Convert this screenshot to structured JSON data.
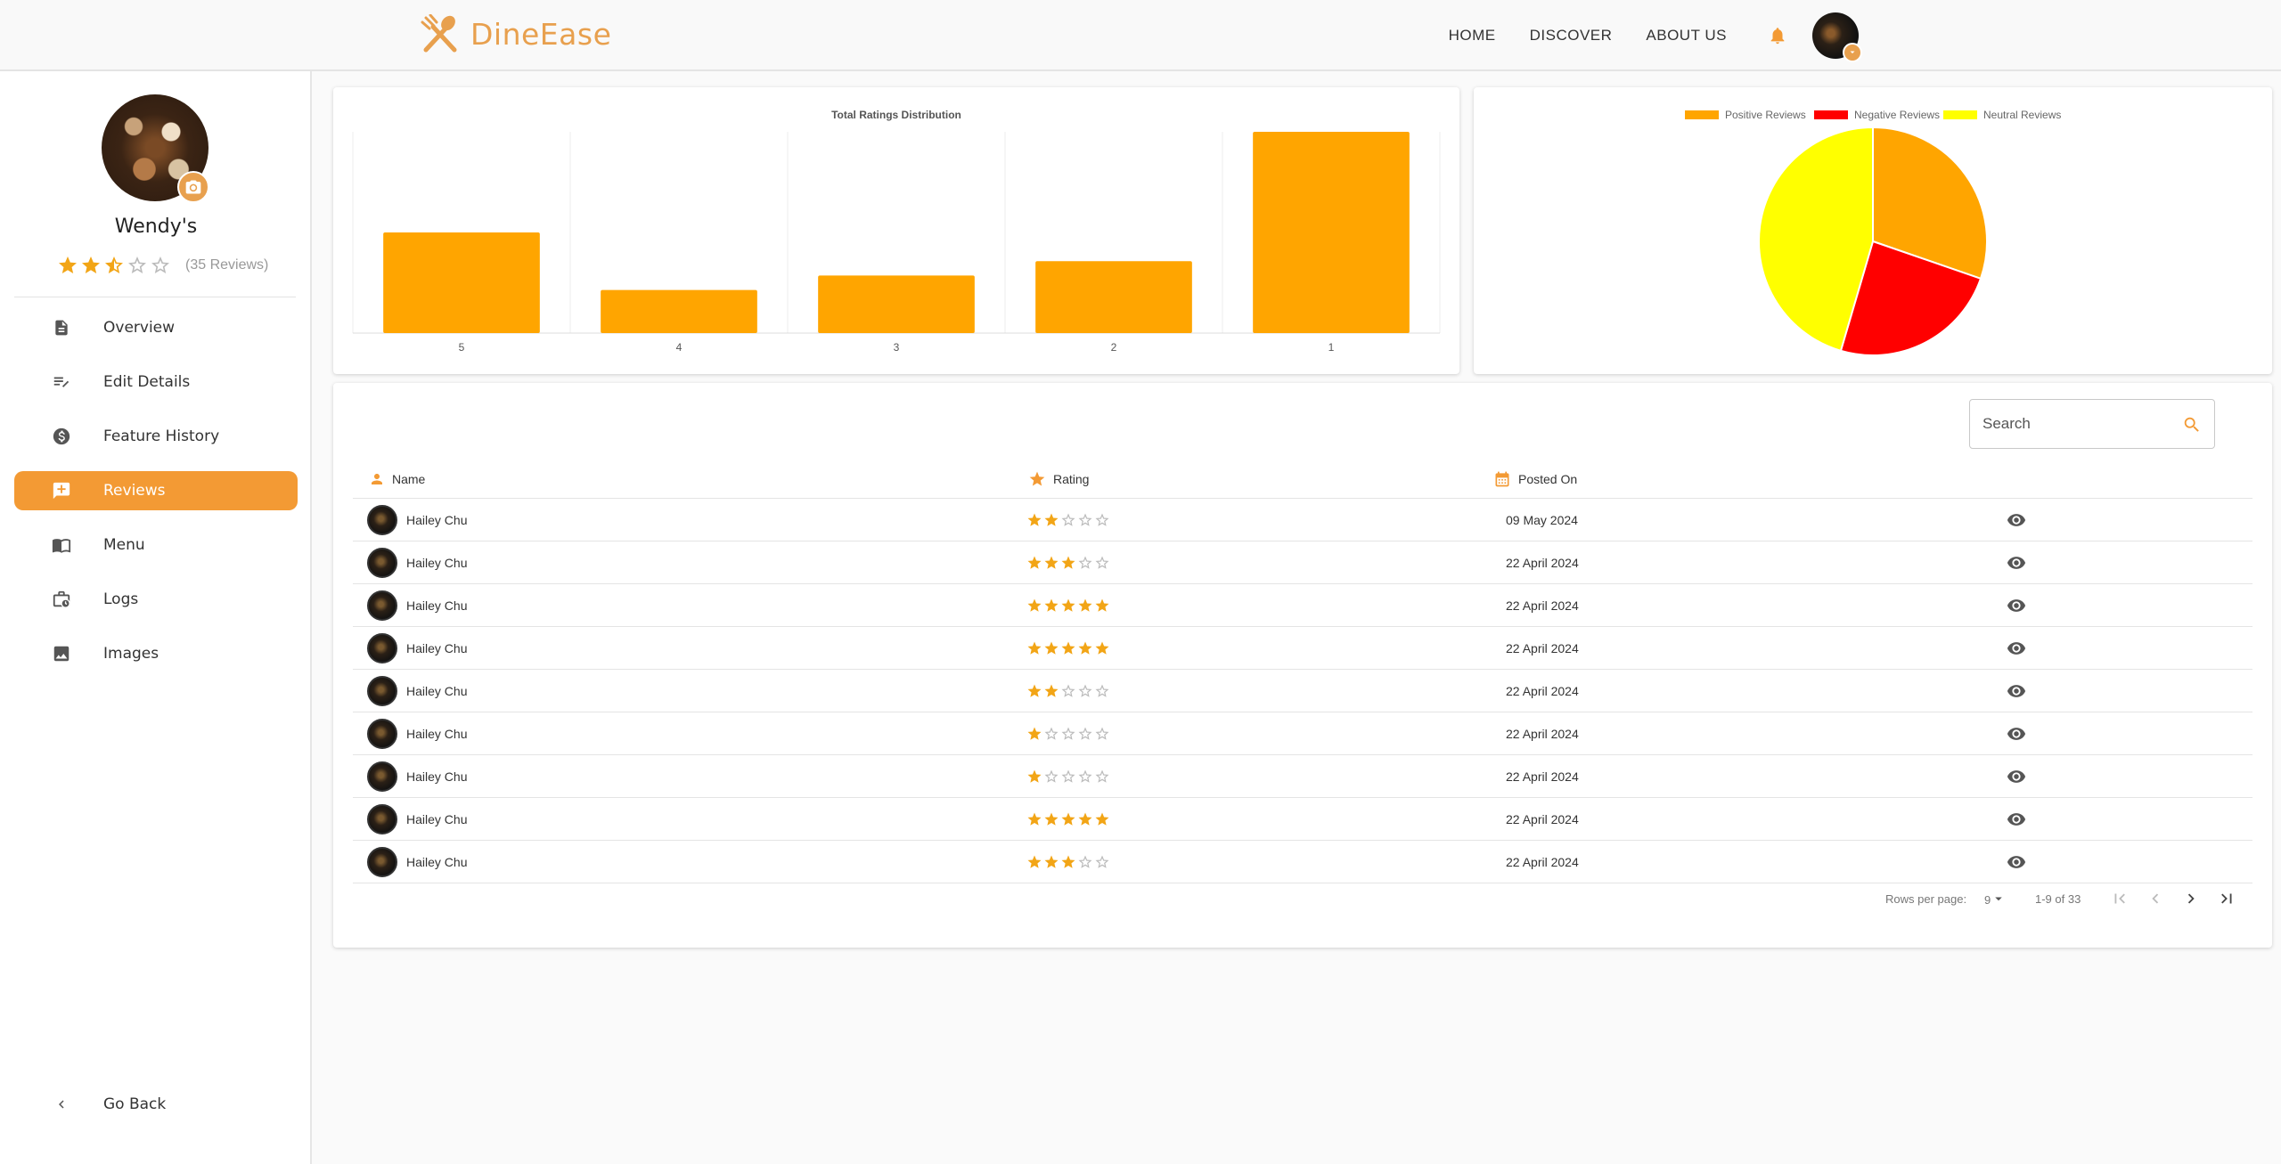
{
  "header": {
    "brand": "DineEase",
    "nav": [
      "HOME",
      "DISCOVER",
      "ABOUT US"
    ]
  },
  "sidebar": {
    "restaurant_name": "Wendy's",
    "rating": 2.5,
    "reviews_label": "(35 Reviews)",
    "items": [
      {
        "label": "Overview",
        "icon": "document-icon",
        "active": false
      },
      {
        "label": "Edit Details",
        "icon": "edit-list-icon",
        "active": false
      },
      {
        "label": "Feature History",
        "icon": "dollar-icon",
        "active": false
      },
      {
        "label": "Reviews",
        "icon": "review-icon",
        "active": true
      },
      {
        "label": "Menu",
        "icon": "menu-book-icon",
        "active": false
      },
      {
        "label": "Logs",
        "icon": "logs-icon",
        "active": false
      },
      {
        "label": "Images",
        "icon": "image-icon",
        "active": false
      }
    ],
    "go_back": "Go Back"
  },
  "colors": {
    "accent": "#f39a34",
    "brand": "#e8a04e",
    "bar": "#ffa500",
    "star": "#f2a516"
  },
  "chart_data": [
    {
      "type": "bar",
      "title": "Total Ratings Distribution",
      "categories": [
        "5",
        "4",
        "3",
        "2",
        "1"
      ],
      "values": [
        7,
        3,
        4,
        5,
        14
      ],
      "ylim": [
        0,
        14
      ],
      "grid": true,
      "color": "#ffa500"
    },
    {
      "type": "pie",
      "labels": [
        "Positive Reviews",
        "Negative Reviews",
        "Neutral Reviews"
      ],
      "values": [
        10,
        8,
        15
      ],
      "colors": [
        "#ffa500",
        "#ff0000",
        "#ffff00"
      ],
      "legend": "top"
    }
  ],
  "table": {
    "search_placeholder": "Search",
    "columns": [
      "Name",
      "Rating",
      "Posted On"
    ],
    "rows": [
      {
        "name": "Hailey Chu",
        "rating": 2,
        "date": "09 May 2024"
      },
      {
        "name": "Hailey Chu",
        "rating": 3,
        "date": "22 April 2024"
      },
      {
        "name": "Hailey Chu",
        "rating": 5,
        "date": "22 April 2024"
      },
      {
        "name": "Hailey Chu",
        "rating": 5,
        "date": "22 April 2024"
      },
      {
        "name": "Hailey Chu",
        "rating": 2,
        "date": "22 April 2024"
      },
      {
        "name": "Hailey Chu",
        "rating": 1,
        "date": "22 April 2024"
      },
      {
        "name": "Hailey Chu",
        "rating": 1,
        "date": "22 April 2024"
      },
      {
        "name": "Hailey Chu",
        "rating": 5,
        "date": "22 April 2024"
      },
      {
        "name": "Hailey Chu",
        "rating": 3,
        "date": "22 April 2024"
      }
    ],
    "pagination": {
      "rows_per_page_label": "Rows per page:",
      "rows_per_page": "9",
      "range": "1-9 of 33"
    }
  }
}
